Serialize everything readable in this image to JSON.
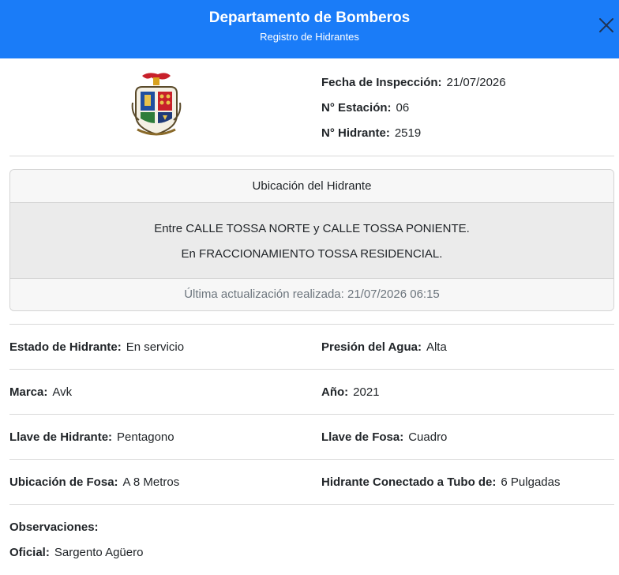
{
  "header": {
    "title": "Departamento de Bomberos",
    "subtitle": "Registro de Hidrantes"
  },
  "info": {
    "fecha_label": "Fecha de Inspección:",
    "fecha_value": "21/07/2026",
    "estacion_label": "N° Estación:",
    "estacion_value": "06",
    "hidrante_label": "N° Hidrante:",
    "hidrante_value": "2519"
  },
  "ubicacion": {
    "header": "Ubicación del Hidrante",
    "line1": "Entre CALLE TOSSA NORTE y CALLE TOSSA PONIENTE.",
    "line2": "En FRACCIONAMIENTO TOSSA RESIDENCIAL.",
    "footer": "Última actualización realizada: 21/07/2026 06:15"
  },
  "details": {
    "estado_label": "Estado de Hidrante:",
    "estado_value": "En servicio",
    "presion_label": "Presión del Agua:",
    "presion_value": "Alta",
    "marca_label": "Marca:",
    "marca_value": "Avk",
    "anio_label": "Año:",
    "anio_value": "2021",
    "llave_hidrante_label": "Llave de Hidrante:",
    "llave_hidrante_value": "Pentagono",
    "llave_fosa_label": "Llave de Fosa:",
    "llave_fosa_value": "Cuadro",
    "ubicacion_fosa_label": "Ubicación de Fosa:",
    "ubicacion_fosa_value": "A 8 Metros",
    "tubo_label": "Hidrante Conectado a Tubo de:",
    "tubo_value": "6 Pulgadas",
    "observaciones_label": "Observaciones:",
    "oficial_label": "Oficial:",
    "oficial_value": "Sargento Agüero"
  },
  "colors": {
    "header_bg": "#1a7cf8",
    "card_body_bg": "#ebebeb"
  }
}
